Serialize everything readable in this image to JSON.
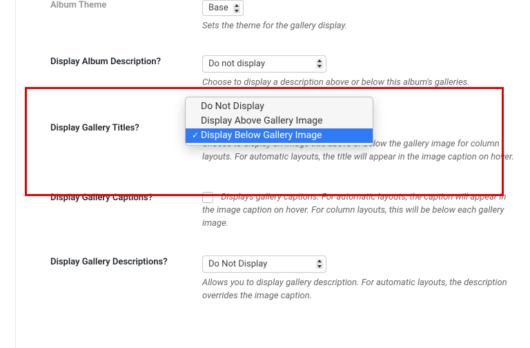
{
  "rows": {
    "albumTheme": {
      "label": "Album Theme",
      "value": "Base",
      "description": "Sets the theme for the gallery display."
    },
    "displayAlbumDescription": {
      "label": "Display Album Description?",
      "value": "Do not display",
      "description": "Choose to display a description above or below this album's galleries."
    },
    "displayGalleryTitles": {
      "label": "Display Gallery Titles?",
      "description": "Choose to display an image title above or below the gallery image for column layouts. For automatic layouts, the title will appear in the image caption on hover."
    },
    "displayGalleryCaptions": {
      "label": "Display Gallery Captions?",
      "description": "Displays gallery captions. For automatic layouts, the caption will appear in the image caption on hover. For column layouts, this will be below each gallery image."
    },
    "displayGalleryDescriptions": {
      "label": "Display Gallery Descriptions?",
      "value": "Do Not Display",
      "description": "Allows you to display gallery description. For automatic layouts, the description overrides the image caption."
    }
  },
  "dropdown": {
    "options": [
      "Do Not Display",
      "Display Above Gallery Image",
      "Display Below Gallery Image"
    ],
    "selectedIndex": 2
  }
}
